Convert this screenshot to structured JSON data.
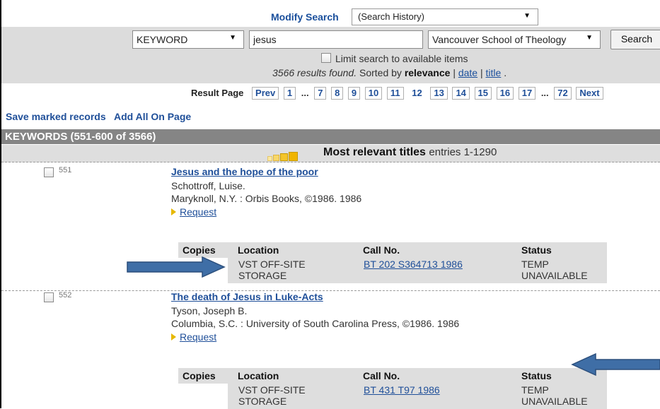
{
  "modify_search": {
    "label": "Modify Search",
    "history_value": "(Search History)"
  },
  "search": {
    "type_value": "KEYWORD",
    "query_value": "jesus",
    "library_value": "Vancouver School of Theology",
    "button_label": "Search",
    "limit_label": "Limit search to available items",
    "results_count": "3566 results found.",
    "sorted_by_prefix": "Sorted by",
    "sort_current": "relevance",
    "sep": "|",
    "sort_date": "date",
    "sort_title": "title",
    "end": "."
  },
  "pager": {
    "label": "Result Page",
    "prev": "Prev",
    "p1": "1",
    "dots1": "...",
    "p7": "7",
    "p8": "8",
    "p9": "9",
    "p10": "10",
    "p11": "11",
    "current": "12",
    "p13": "13",
    "p14": "14",
    "p15": "15",
    "p16": "16",
    "p17": "17",
    "dots2": "...",
    "p72": "72",
    "next": "Next"
  },
  "actions": {
    "save_marked": "Save marked records",
    "add_all": "Add All On Page"
  },
  "keywords_bar": "KEYWORDS (551-600 of 3566)",
  "relevance": {
    "title": "Most relevant titles",
    "entries": "entries 1-1290"
  },
  "records": [
    {
      "num": "551",
      "title": "Jesus and the hope of the poor",
      "author": "Schottroff, Luise.",
      "pub": "Maryknoll, N.Y. : Orbis Books, ©1986. 1986",
      "request": "Request",
      "headers": {
        "copies": "Copies",
        "location": "Location",
        "call": "Call No.",
        "status": "Status"
      },
      "location": "VST OFF-SITE STORAGE",
      "call_no": "BT 202 S364713 1986",
      "status": "TEMP UNAVAILABLE"
    },
    {
      "num": "552",
      "title": "The death of Jesus in Luke-Acts",
      "author": "Tyson, Joseph B.",
      "pub": "Columbia, S.C. : University of South Carolina Press, ©1986. 1986",
      "request": "Request",
      "headers": {
        "copies": "Copies",
        "location": "Location",
        "call": "Call No.",
        "status": "Status"
      },
      "location": "VST OFF-SITE STORAGE",
      "call_no": "BT 431 T97 1986",
      "status": "TEMP UNAVAILABLE"
    }
  ],
  "colors": {
    "link": "#1f4f99",
    "arrow": "#3f6ea6",
    "panel": "#dcdcdc",
    "bar": "#858585"
  }
}
